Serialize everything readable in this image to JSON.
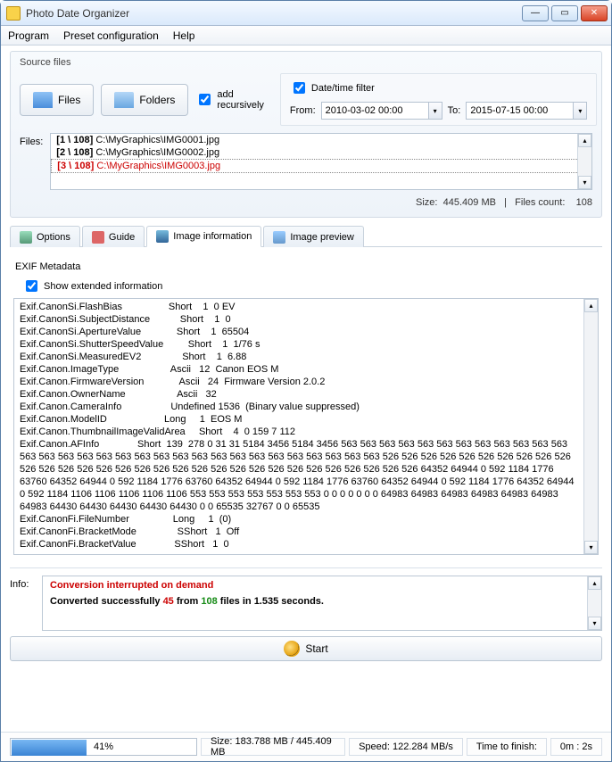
{
  "window": {
    "title": "Photo Date Organizer"
  },
  "menu": {
    "program": "Program",
    "preset": "Preset configuration",
    "help": "Help"
  },
  "source": {
    "label": "Source files",
    "files_btn": "Files",
    "folders_btn": "Folders",
    "recursive": "add recursively",
    "filter_label": "Date/time filter",
    "from_label": "From:",
    "to_label": "To:",
    "from_val": "2010-03-02 00:00",
    "to_val": "2015-07-15 00:00",
    "list_label": "Files:",
    "items": [
      {
        "idx": "[1 \\ 108]",
        "path": "C:\\MyGraphics\\IMG0001.jpg"
      },
      {
        "idx": "[2 \\ 108]",
        "path": "C:\\MyGraphics\\IMG0002.jpg"
      },
      {
        "idx": "[3 \\ 108]",
        "path": "C:\\MyGraphics\\IMG0003.jpg"
      }
    ],
    "stat_size_label": "Size:",
    "stat_size": "445.409 MB",
    "stat_count_label": "Files count:",
    "stat_count": "108"
  },
  "tabs": {
    "options": "Options",
    "guide": "Guide",
    "info": "Image information",
    "preview": "Image preview"
  },
  "exif": {
    "header": "EXIF Metadata",
    "show_ext": "Show extended information",
    "text": "Exif.CanonSi.FlashBias                 Short    1  0 EV\nExif.CanonSi.SubjectDistance           Short    1  0\nExif.CanonSi.ApertureValue             Short    1  65504\nExif.CanonSi.ShutterSpeedValue         Short    1  1/76 s\nExif.CanonSi.MeasuredEV2               Short    1  6.88\nExif.Canon.ImageType                   Ascii   12  Canon EOS M\nExif.Canon.FirmwareVersion             Ascii   24  Firmware Version 2.0.2\nExif.Canon.OwnerName                   Ascii   32\nExif.Canon.CameraInfo                  Undefined 1536  (Binary value suppressed)\nExif.Canon.ModelID                     Long     1  EOS M\nExif.Canon.ThumbnailImageValidArea     Short    4  0 159 7 112\nExif.Canon.AFInfo              Short  139  278 0 31 31 5184 3456 5184 3456 563 563 563 563 563 563 563 563 563 563 563 563 563 563 563 563 563 563 563 563 563 563 563 563 563 563 563 563 563 563 563 526 526 526 526 526 526 526 526 526 526 526 526 526 526 526 526 526 526 526 526 526 526 526 526 526 526 526 526 526 526 526 64352 64944 0 592 1184 1776 63760 64352 64944 0 592 1184 1776 63760 64352 64944 0 592 1184 1776 63760 64352 64944 0 592 1184 1776 64352 64944 0 592 1184 1106 1106 1106 1106 1106 553 553 553 553 553 553 553 0 0 0 0 0 0 0 64983 64983 64983 64983 64983 64983 64983 64430 64430 64430 64430 64430 0 0 65535 32767 0 0 65535\nExif.CanonFi.FileNumber                Long     1  (0)\nExif.CanonFi.BracketMode               SShort   1  Off\nExif.CanonFi.BracketValue              SShort   1  0"
  },
  "info": {
    "label": "Info:",
    "l1": "Conversion interrupted on demand",
    "l2_a": "Converted successfully ",
    "l2_r": "45",
    "l2_b": " from ",
    "l2_g": "108",
    "l2_c": " files in 1.535 seconds."
  },
  "start": {
    "label": "Start"
  },
  "status": {
    "progress_pct": 41,
    "progress_text": "41%",
    "size_text": "Size:  183.788 MB  /  445.409 MB",
    "speed_text": "Speed:  122.284 MB/s",
    "ttf_label": "Time to finish:",
    "ttf_val": "0m : 2s"
  }
}
